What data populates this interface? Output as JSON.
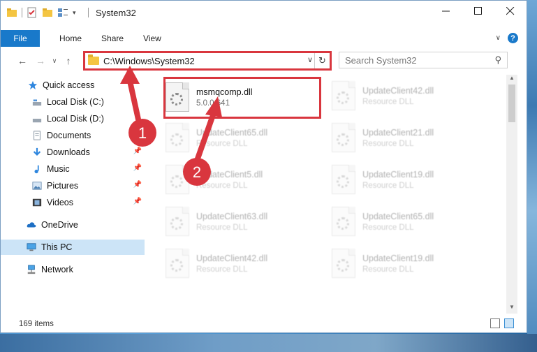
{
  "window": {
    "title": "System32"
  },
  "ribbon": {
    "tabs": [
      "File",
      "Home",
      "Share",
      "View"
    ]
  },
  "address": {
    "path": "C:\\Windows\\System32",
    "search_placeholder": "Search System32"
  },
  "nav": {
    "items": [
      {
        "label": "Quick access",
        "icon": "star-icon"
      },
      {
        "label": "Local Disk (C:)",
        "icon": "drive-icon"
      },
      {
        "label": "Local Disk (D:)",
        "icon": "drive-icon"
      },
      {
        "label": "Documents",
        "icon": "documents-icon"
      },
      {
        "label": "Downloads",
        "icon": "download-icon"
      },
      {
        "label": "Music",
        "icon": "music-icon"
      },
      {
        "label": "Pictures",
        "icon": "pictures-icon"
      },
      {
        "label": "Videos",
        "icon": "videos-icon"
      },
      {
        "label": "OneDrive",
        "icon": "cloud-icon"
      },
      {
        "label": "This PC",
        "icon": "computer-icon"
      },
      {
        "label": "Network",
        "icon": "network-icon"
      }
    ]
  },
  "files": [
    {
      "name": "msmqcomp.dll",
      "sub": "5.0.0.641"
    },
    {
      "name": "UpdateClient42.dll",
      "sub": "Resource DLL"
    },
    {
      "name": "UpdateClient65.dll",
      "sub": "Resource DLL"
    },
    {
      "name": "UpdateClient21.dll",
      "sub": "Resource DLL"
    },
    {
      "name": "UpdateClient5.dll",
      "sub": "Resource DLL"
    },
    {
      "name": "UpdateClient19.dll",
      "sub": "Resource DLL"
    },
    {
      "name": "UpdateClient63.dll",
      "sub": "Resource DLL"
    },
    {
      "name": "UpdateClient65.dll",
      "sub": "Resource DLL"
    },
    {
      "name": "UpdateClient42.dll",
      "sub": "Resource DLL"
    },
    {
      "name": "UpdateClient19.dll",
      "sub": "Resource DLL"
    }
  ],
  "status": {
    "item_count": "169 items"
  },
  "annotations": {
    "badge1": "1",
    "badge2": "2",
    "color": "#d9363e"
  }
}
